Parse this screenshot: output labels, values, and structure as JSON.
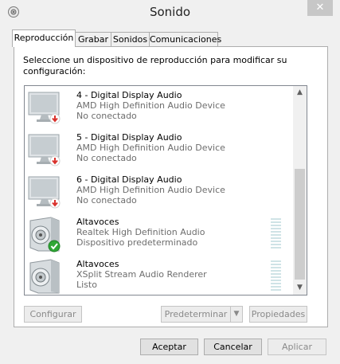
{
  "window": {
    "title": "Sonido",
    "close_glyph": "✕",
    "icon": "speaker-icon"
  },
  "tabs": [
    {
      "label": "Reproducción",
      "active": true
    },
    {
      "label": "Grabar",
      "active": false
    },
    {
      "label": "Sonidos",
      "active": false
    },
    {
      "label": "Comunicaciones",
      "active": false
    }
  ],
  "panel": {
    "instructions": "Seleccione un dispositivo de reproducción para modificar su configuración:"
  },
  "devices": [
    {
      "name": "4 - Digital Display Audio",
      "description": "AMD High Definition Audio Device",
      "status": "No conectado",
      "type": "monitor",
      "badge": "disconnected"
    },
    {
      "name": "5 - Digital Display Audio",
      "description": "AMD High Definition Audio Device",
      "status": "No conectado",
      "type": "monitor",
      "badge": "disconnected"
    },
    {
      "name": "6 - Digital Display Audio",
      "description": "AMD High Definition Audio Device",
      "status": "No conectado",
      "type": "monitor",
      "badge": "disconnected"
    },
    {
      "name": "Altavoces",
      "description": "Realtek High Definition Audio",
      "status": "Dispositivo predeterminado",
      "type": "speaker",
      "badge": "default"
    },
    {
      "name": "Altavoces",
      "description": "XSplit  Stream  Audio  Renderer",
      "status": "Listo",
      "type": "speaker",
      "badge": "none"
    }
  ],
  "panel_buttons": {
    "configure": "Configurar",
    "set_default": "Predeterminar",
    "set_default_arrow": "▼",
    "properties": "Propiedades"
  },
  "scrollbar": {
    "up": "▲",
    "down": "▼"
  },
  "dialog_buttons": {
    "accept": "Aceptar",
    "cancel": "Cancelar",
    "apply": "Aplicar"
  },
  "colors": {
    "background": "#f0f0f0",
    "disconnected_badge": "#d9302b",
    "default_badge": "#2fa735",
    "level_meter": "#cfe3e6"
  }
}
